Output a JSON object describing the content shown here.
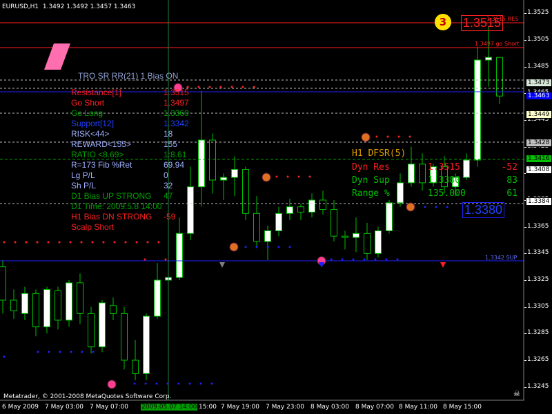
{
  "header": {
    "symbol": "EURUSD,H1",
    "ohlc": "1.3492 1.3492 1.3457 1.3463"
  },
  "copyright": "Metatrader, © 2001-2008 MetaQuotes Software Corp.",
  "price_axis": {
    "ticks": [
      "1.3525",
      "1.3505",
      "1.3485",
      "1.3465",
      "1.3445",
      "1.3425",
      "1.3405",
      "1.3385",
      "1.3365",
      "1.3345",
      "1.3325",
      "1.3305",
      "1.3285",
      "1.3265",
      "1.3245"
    ],
    "tags": [
      {
        "text": "1.3473",
        "bg": "#d8e8d8",
        "fg": "#000"
      },
      {
        "text": "1.3463",
        "bg": "#0000ff",
        "fg": "#fff"
      },
      {
        "text": "1.3449",
        "bg": "#ffffcc",
        "fg": "#000"
      },
      {
        "text": "1.3428",
        "bg": "#c0c0c0",
        "fg": "#000"
      },
      {
        "text": "1.3416",
        "bg": "#00c000",
        "fg": "#000"
      },
      {
        "text": "1.3408",
        "bg": "#ffffff",
        "fg": "#000"
      },
      {
        "text": "1.3384",
        "bg": "#ffffff",
        "fg": "#000"
      }
    ]
  },
  "time_axis": {
    "labels": [
      "6 May 2009",
      "7 May 03:00",
      "7 May 07:00",
      "15:00",
      "7 May 19:00",
      "7 May 23:00",
      "8 May 03:00",
      "8 May 07:00",
      "8 May 11:00",
      "8 May 15:00"
    ],
    "highlight": "2009.05.07 14:00"
  },
  "hlines": {
    "res_label": "1.3515 RES",
    "res_big": "1.3515",
    "res_marker": "3",
    "goshort_label": "1.3497 go Short",
    "sup_label": "1.3342 SUP",
    "sup_big": "1.3380"
  },
  "info_panel": {
    "title": "TRO SR RR(21) 1 Bias ON",
    "rows": [
      {
        "label": "Resistance[1]",
        "value": "1.3515",
        "color": "#ff2020"
      },
      {
        "label": "Go Short",
        "value": "1.3497",
        "color": "#ff2020"
      },
      {
        "label": "Go Long",
        "value": "1.3360",
        "color": "#00a000"
      },
      {
        "label": "Support[12]",
        "value": "1.3342",
        "color": "#2040ff"
      },
      {
        "label": "RISK<44>",
        "value": "18",
        "color": "#a0b0ff"
      },
      {
        "label": "REWARD<155>",
        "value": "155",
        "color": "#a0b0ff"
      },
      {
        "label": "RATIO <8.69>",
        "value": "1:8.61",
        "color": "#00a000"
      },
      {
        "label": "R=173 Fib %Ret",
        "value": "69.94",
        "color": "#a0b0ff"
      },
      {
        "label": "Lg P/L",
        "value": "0",
        "color": "#a0b0ff"
      },
      {
        "label": "Sh P/L",
        "value": "32",
        "color": "#a0b0ff"
      },
      {
        "label": "D1 Bias UP STRONG",
        "value": "47",
        "color": "#00a000"
      },
      {
        "label": "D1 Time: 2009.5.8 14:00",
        "value": "",
        "color": "#00a000"
      },
      {
        "label": "H1 Bias DN STRONG",
        "value": "-59",
        "color": "#ff2020"
      },
      {
        "label": "Scalp Short",
        "value": "",
        "color": "#ff2020"
      }
    ]
  },
  "dfsr_panel": {
    "title": "H1 DFSR(5)",
    "rows": [
      {
        "label": "Dyn Res",
        "value": "1.3515",
        "extra": "-52",
        "color": "#ff2020"
      },
      {
        "label": "Dyn Sup",
        "value": "1.3380",
        "extra": "83",
        "color": "#00c000"
      },
      {
        "label": "Range %",
        "value": "135.000",
        "extra": "61",
        "color": "#00c000"
      }
    ]
  },
  "colors": {
    "bull_body": "#ffffff",
    "bear_body": "#000000",
    "wick": "#00c000",
    "resistance": "#ff2020",
    "support": "#2020ff",
    "dashed": "#c0c0c0"
  },
  "chart_data": {
    "type": "candlestick",
    "symbol": "EURUSD",
    "timeframe": "H1",
    "ylim": [
      1.3235,
      1.3535
    ],
    "candles": [
      {
        "o": 1.3335,
        "h": 1.334,
        "c": 1.331,
        "l": 1.33
      },
      {
        "o": 1.331,
        "h": 1.3318,
        "c": 1.3302,
        "l": 1.3296
      },
      {
        "o": 1.33,
        "h": 1.332,
        "c": 1.3315,
        "l": 1.3295
      },
      {
        "o": 1.3315,
        "h": 1.3318,
        "c": 1.329,
        "l": 1.3283
      },
      {
        "o": 1.329,
        "h": 1.332,
        "c": 1.3318,
        "l": 1.3285
      },
      {
        "o": 1.3317,
        "h": 1.332,
        "c": 1.3295,
        "l": 1.3288
      },
      {
        "o": 1.3295,
        "h": 1.3325,
        "c": 1.3323,
        "l": 1.329
      },
      {
        "o": 1.3323,
        "h": 1.333,
        "c": 1.33,
        "l": 1.3292
      },
      {
        "o": 1.33,
        "h": 1.3305,
        "c": 1.3275,
        "l": 1.327
      },
      {
        "o": 1.3275,
        "h": 1.331,
        "c": 1.3308,
        "l": 1.3271
      },
      {
        "o": 1.3306,
        "h": 1.3312,
        "c": 1.33,
        "l": 1.3295
      },
      {
        "o": 1.33,
        "h": 1.3305,
        "c": 1.3265,
        "l": 1.3258
      },
      {
        "o": 1.3265,
        "h": 1.328,
        "c": 1.3255,
        "l": 1.325
      },
      {
        "o": 1.3255,
        "h": 1.33,
        "c": 1.3298,
        "l": 1.325
      },
      {
        "o": 1.3298,
        "h": 1.3338,
        "c": 1.3325,
        "l": 1.3296
      },
      {
        "o": 1.3325,
        "h": 1.3345,
        "c": 1.3327,
        "l": 1.331
      },
      {
        "o": 1.3327,
        "h": 1.3372,
        "c": 1.336,
        "l": 1.3325
      },
      {
        "o": 1.336,
        "h": 1.341,
        "c": 1.3395,
        "l": 1.3355
      },
      {
        "o": 1.3395,
        "h": 1.3467,
        "c": 1.343,
        "l": 1.338
      },
      {
        "o": 1.343,
        "h": 1.3435,
        "c": 1.34,
        "l": 1.339
      },
      {
        "o": 1.34,
        "h": 1.3405,
        "c": 1.3402,
        "l": 1.3385
      },
      {
        "o": 1.3402,
        "h": 1.3418,
        "c": 1.3408,
        "l": 1.3388
      },
      {
        "o": 1.3408,
        "h": 1.341,
        "c": 1.3375,
        "l": 1.337
      },
      {
        "o": 1.3375,
        "h": 1.3388,
        "c": 1.3354,
        "l": 1.3349
      },
      {
        "o": 1.3354,
        "h": 1.3366,
        "c": 1.3362,
        "l": 1.334
      },
      {
        "o": 1.3362,
        "h": 1.338,
        "c": 1.3375,
        "l": 1.3358
      },
      {
        "o": 1.3375,
        "h": 1.3386,
        "c": 1.338,
        "l": 1.337
      },
      {
        "o": 1.338,
        "h": 1.3382,
        "c": 1.3376,
        "l": 1.337
      },
      {
        "o": 1.3376,
        "h": 1.339,
        "c": 1.3385,
        "l": 1.3372
      },
      {
        "o": 1.3385,
        "h": 1.3392,
        "c": 1.3378,
        "l": 1.3374
      },
      {
        "o": 1.3378,
        "h": 1.3385,
        "c": 1.3358,
        "l": 1.3354
      },
      {
        "o": 1.3358,
        "h": 1.3362,
        "c": 1.3357,
        "l": 1.3348
      },
      {
        "o": 1.3357,
        "h": 1.3372,
        "c": 1.336,
        "l": 1.3346
      },
      {
        "o": 1.336,
        "h": 1.3368,
        "c": 1.3345,
        "l": 1.334
      },
      {
        "o": 1.3345,
        "h": 1.3365,
        "c": 1.3362,
        "l": 1.3342
      },
      {
        "o": 1.3362,
        "h": 1.3385,
        "c": 1.3383,
        "l": 1.336
      },
      {
        "o": 1.3383,
        "h": 1.3405,
        "c": 1.3398,
        "l": 1.338
      },
      {
        "o": 1.3398,
        "h": 1.3425,
        "c": 1.3412,
        "l": 1.3395
      },
      {
        "o": 1.3412,
        "h": 1.342,
        "c": 1.3398,
        "l": 1.3392
      },
      {
        "o": 1.3398,
        "h": 1.3412,
        "c": 1.341,
        "l": 1.3395
      },
      {
        "o": 1.341,
        "h": 1.3418,
        "c": 1.3395,
        "l": 1.339
      },
      {
        "o": 1.3395,
        "h": 1.3405,
        "c": 1.3402,
        "l": 1.3388
      },
      {
        "o": 1.3402,
        "h": 1.342,
        "c": 1.3415,
        "l": 1.34
      },
      {
        "o": 1.3415,
        "h": 1.35,
        "c": 1.349,
        "l": 1.341
      },
      {
        "o": 1.349,
        "h": 1.3515,
        "c": 1.3492,
        "l": 1.347
      },
      {
        "o": 1.3492,
        "h": 1.3492,
        "c": 1.3463,
        "l": 1.3457
      }
    ]
  }
}
